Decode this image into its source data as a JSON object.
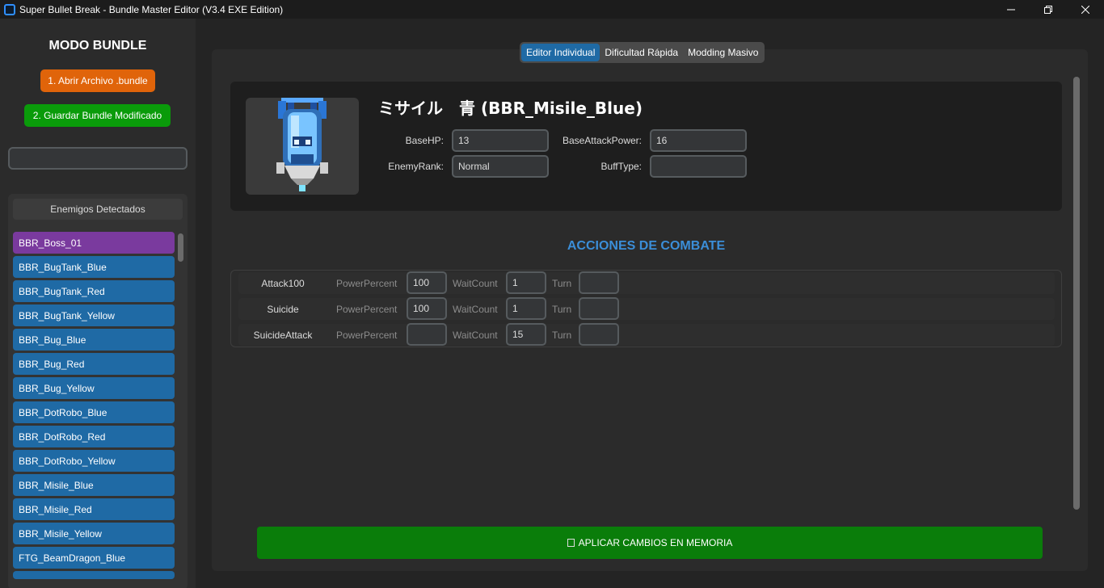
{
  "window": {
    "title": "Super Bullet Break - Bundle Master Editor (V3.4 EXE Edition)",
    "controls": [
      "minimize-icon",
      "restore-icon",
      "close-icon"
    ]
  },
  "sidebar": {
    "mode_title": "MODO BUNDLE",
    "open_button": "1. Abrir Archivo .bundle",
    "save_button": "2. Guardar Bundle Modificado",
    "search_value": "",
    "list_header": "Enemigos Detectados",
    "enemies": [
      "BBR_Boss_01",
      "BBR_BugTank_Blue",
      "BBR_BugTank_Red",
      "BBR_BugTank_Yellow",
      "BBR_Bug_Blue",
      "BBR_Bug_Red",
      "BBR_Bug_Yellow",
      "BBR_DotRobo_Blue",
      "BBR_DotRobo_Red",
      "BBR_DotRobo_Yellow",
      "BBR_Misile_Blue",
      "BBR_Misile_Red",
      "BBR_Misile_Yellow",
      "FTG_BeamDragon_Blue"
    ],
    "selected_enemy": "BBR_Boss_01"
  },
  "tabs": [
    "Editor Individual",
    "Dificultad Rápida",
    "Modding Masivo"
  ],
  "active_tab": "Editor Individual",
  "enemy": {
    "name": "ミサイル　青 (BBR_Misile_Blue)",
    "base_hp_label": "BaseHP:",
    "base_hp": "13",
    "base_attack_label": "BaseAttackPower:",
    "base_attack": "16",
    "rank_label": "EnemyRank:",
    "rank": "Normal",
    "buff_label": "BuffType:",
    "buff": ""
  },
  "actions_title": "ACCIONES DE COMBATE",
  "action_labels": {
    "power": "PowerPercent",
    "wait": "WaitCount",
    "turn": "Turn"
  },
  "actions": [
    {
      "name": "Attack100",
      "power": "100",
      "wait": "1",
      "turn": ""
    },
    {
      "name": "Suicide",
      "power": "100",
      "wait": "1",
      "turn": ""
    },
    {
      "name": "SuicideAttack",
      "power": "",
      "wait": "15",
      "turn": ""
    }
  ],
  "apply_button": "APLICAR CAMBIOS EN MEMORIA",
  "colors": {
    "accent_blue": "#1f6aa5",
    "boss_purple": "#7a3a9e",
    "open_orange": "#e0640a",
    "save_green": "#0a9b0a",
    "apply_green": "#0a7d0a",
    "section_title_blue": "#3b8ed8"
  }
}
